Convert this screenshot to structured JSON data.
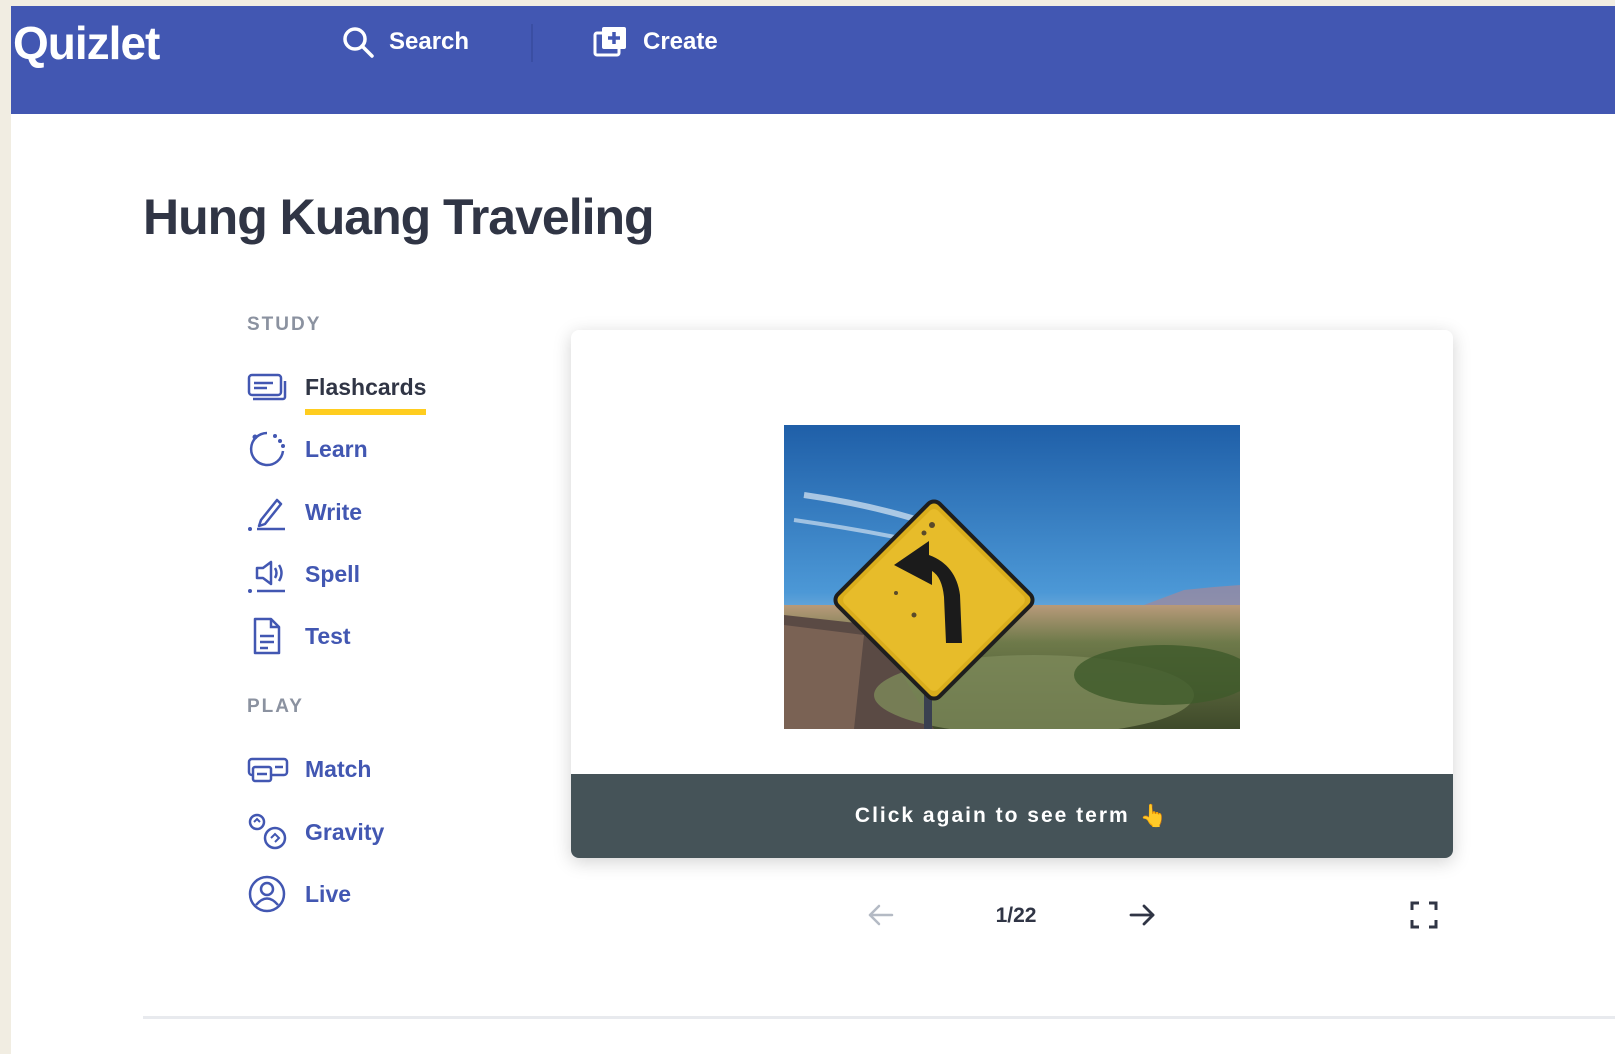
{
  "header": {
    "logo": "Quizlet",
    "search_label": "Search",
    "create_label": "Create"
  },
  "set": {
    "title": "Hung Kuang Traveling"
  },
  "sidebar": {
    "study_heading": "STUDY",
    "play_heading": "PLAY",
    "study_items": [
      {
        "label": "Flashcards",
        "icon": "flashcards-icon",
        "active": true
      },
      {
        "label": "Learn",
        "icon": "learn-icon"
      },
      {
        "label": "Write",
        "icon": "write-icon"
      },
      {
        "label": "Spell",
        "icon": "spell-icon"
      },
      {
        "label": "Test",
        "icon": "test-icon"
      }
    ],
    "play_items": [
      {
        "label": "Match",
        "icon": "match-icon"
      },
      {
        "label": "Gravity",
        "icon": "gravity-icon"
      },
      {
        "label": "Live",
        "icon": "live-icon"
      }
    ]
  },
  "flashcard": {
    "image": "curve-road-sign-photo",
    "hint": "Click again to see term",
    "hint_icon": "pointing-hand-icon"
  },
  "navigation": {
    "counter": "1/22",
    "prev_icon": "arrow-left-icon",
    "next_icon": "arrow-right-icon",
    "fullscreen_icon": "fullscreen-icon"
  },
  "colors": {
    "brand": "#4257b2",
    "accent_underline": "#ffcd1f",
    "card_footer": "#455358",
    "title_text": "#303545"
  }
}
